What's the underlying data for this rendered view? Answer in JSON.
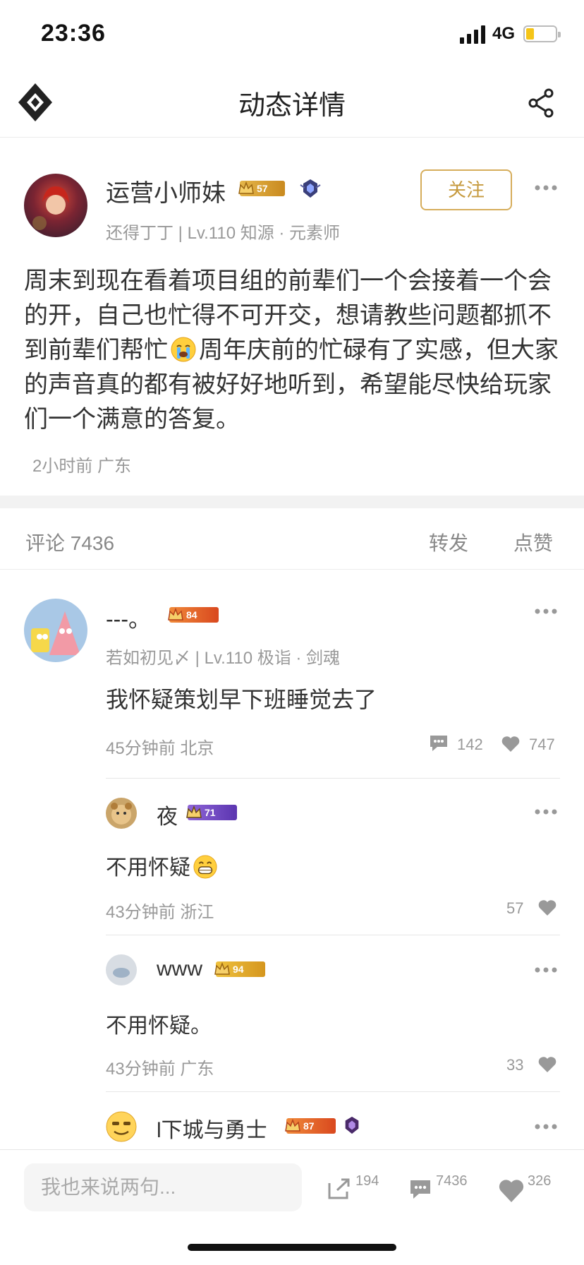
{
  "status": {
    "time": "23:36",
    "network": "4G"
  },
  "nav": {
    "title": "动态详情",
    "logo_icon": "diamond-logo-icon",
    "share_icon": "share-icon"
  },
  "post": {
    "author": "运营小师妹",
    "level_badge": "57",
    "meta": "还得丁丁 | Lv.110 知源 · 元素师",
    "follow_label": "关注",
    "text_part1": "周末到现在看着项目组的前辈们一个会接着一个会的开，自己也忙得不可开交，想请教些问题都抓不到前辈们帮忙",
    "text_part2": "周年庆前的忙碌有了实感，但大家的声音真的都有被好好地听到，希望能尽快给玩家们一个满意的答复。",
    "time": "2小时前 广东"
  },
  "tabs": {
    "comments": "评论  7436",
    "forward": "转发",
    "like": "点赞"
  },
  "comments": [
    {
      "author": "---。",
      "level_badge": "84",
      "meta": "若如初见〆 | Lv.110 极诣 · 剑魂",
      "text": "我怀疑策划早下班睡觉去了",
      "time": "45分钟前 北京",
      "replies_count": "142",
      "likes": "747",
      "replies": [
        {
          "author": "夜",
          "level_badge": "71",
          "text": "不用怀疑",
          "time": "43分钟前 浙江",
          "likes": "57"
        },
        {
          "author": "www",
          "level_badge": "94",
          "text": "不用怀疑。",
          "time": "43分钟前 广东",
          "likes": "33"
        },
        {
          "author": "l下城与勇士",
          "level_badge": "87"
        }
      ]
    }
  ],
  "bottom": {
    "placeholder": "我也来说两句...",
    "forward_count": "194",
    "comment_count": "7436",
    "like_count": "326"
  },
  "colors": {
    "accent_gold": "#c69a3e",
    "badge_orange": "#e0662a",
    "badge_purple": "#7a4fc8",
    "badge_gold": "#d9a82c"
  }
}
